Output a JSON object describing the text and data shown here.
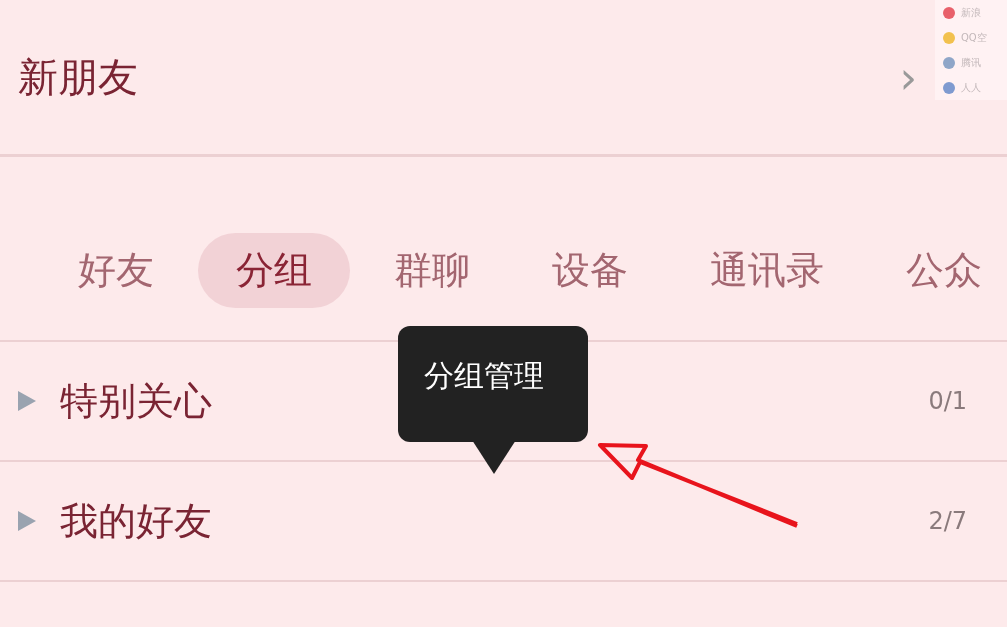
{
  "header": {
    "title": "新朋友",
    "chevron": "›"
  },
  "share_menu": [
    {
      "label": "新浪",
      "color": "#e8606a"
    },
    {
      "label": "QQ空",
      "color": "#f2c14e"
    },
    {
      "label": "腾讯",
      "color": "#8fa6c8"
    },
    {
      "label": "人人",
      "color": "#7f9bd0"
    }
  ],
  "tabs": [
    {
      "label": "好友",
      "selected": false
    },
    {
      "label": "分组",
      "selected": true
    },
    {
      "label": "群聊",
      "selected": false
    },
    {
      "label": "设备",
      "selected": false
    },
    {
      "label": "通讯录",
      "selected": false
    },
    {
      "label": "公众",
      "selected": false
    }
  ],
  "tooltip": {
    "text": "分组管理"
  },
  "groups": [
    {
      "name": "特别关心",
      "count": "0/1",
      "expanded": false
    },
    {
      "name": "我的好友",
      "count": "2/7",
      "expanded": false
    }
  ]
}
